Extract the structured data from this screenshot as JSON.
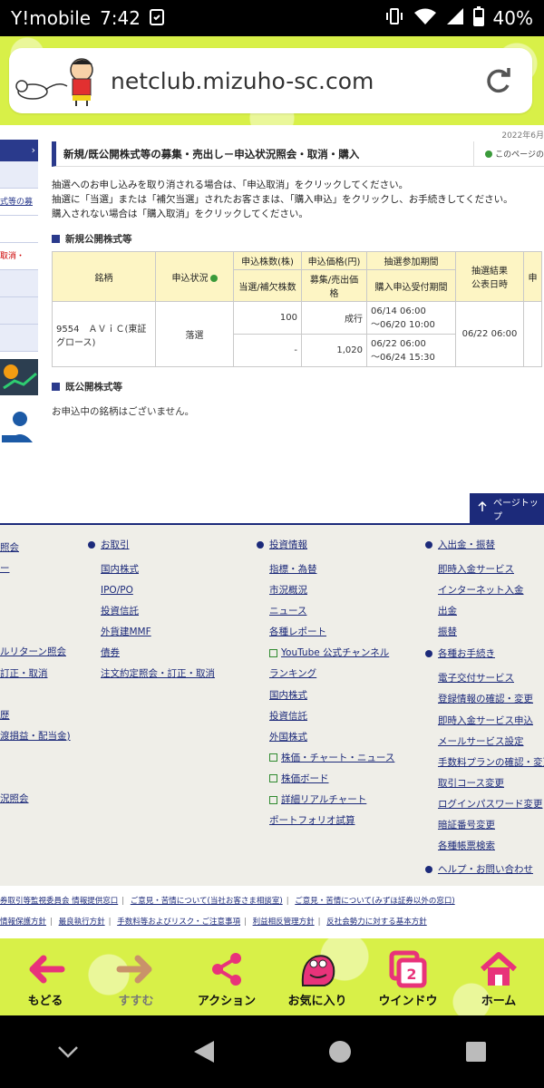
{
  "status": {
    "carrier": "Y!mobile",
    "time": "7:42",
    "battery": "40%"
  },
  "browser": {
    "url": "netclub.mizuho-sc.com"
  },
  "page": {
    "date_top": "2022年6月",
    "title": "新規/既公開株式等の募集・売出し－申込状況照会・取消・購入",
    "help_label": "このページの",
    "notes": [
      "抽選へのお申し込みを取り消される場合は、「申込取消」をクリックしてください。",
      "抽選に「当選」または「補欠当選」されたお客さまは、「購入申込」をクリックし、お手続きしてください。",
      "購入されない場合は「購入取消」をクリックしてください。"
    ],
    "sidebar_items": [
      "",
      "式等の募",
      "",
      "取消・",
      "",
      "",
      ""
    ],
    "section_new": "新規公開株式等",
    "table": {
      "h_name": "銘柄",
      "h_status": "申込状況",
      "h_qty": "申込株数(株)",
      "h_qty2": "当選/補欠株数",
      "h_price": "申込価格(円)",
      "h_price2": "募集/売出価格",
      "h_period": "抽選参加期間",
      "h_period2": "購入申込受付期間",
      "h_result": "抽選結果\n公表日時",
      "h_extra": "申",
      "row": {
        "name": "9554　ＡＶｉＣ(東証グロース)",
        "status": "落選",
        "qty": "100",
        "qty2": "-",
        "price": "成行",
        "price2": "1,020",
        "period_a": "06/14 06:00",
        "period_b": "～06/20 10:00",
        "period2_a": "06/22 06:00",
        "period2_b": "～06/24 15:30",
        "result": "06/22 06:00"
      }
    },
    "section_old": "既公開株式等",
    "no_entry": "お申込中の銘柄はございません。",
    "pagetop": "ページトップ"
  },
  "footer": {
    "col1": [
      "照会",
      "ー",
      "",
      "",
      "",
      "ルリターン照会",
      "訂正・取消",
      "",
      "歴",
      "渡損益・配当金)",
      "",
      "",
      "況照会"
    ],
    "col2_title": "お取引",
    "col2": [
      "国内株式",
      "IPO/PO",
      "投資信託",
      "外貨建MMF",
      "債券",
      "注文約定照会・訂正・取消"
    ],
    "col3_title": "投資情報",
    "col3": [
      "指標・為替",
      "市況概況",
      "ニュース",
      "各種レポート",
      "YouTube 公式チャンネル",
      "ランキング",
      "国内株式",
      "投資信託",
      "外国株式",
      "株価・チャート・ニュース",
      "株価ボード",
      "詳細リアルチャート",
      "ポートフォリオ試算"
    ],
    "col4_title": "入出金・振替",
    "col4": [
      "即時入金サービス",
      "インターネット入金",
      "出金",
      "振替"
    ],
    "col4_title2": "各種お手続き",
    "col4b": [
      "電子交付サービス",
      "登録情報の確認・変更",
      "即時入金サービス申込",
      "メールサービス設定",
      "手数料プランの確認・変更",
      "取引コース変更",
      "ログインパスワード変更",
      "暗証番号変更",
      "各種帳票検索"
    ],
    "col4_title3": "ヘルプ・お問い合わせ",
    "legal_row1": [
      "券取引等監視委員会 情報提供窓口",
      "ご意見・苦情について(当社お客さま相談室)",
      "ご意見・苦情について(みずほ証券以外の窓口)"
    ],
    "legal_row2": [
      "情報保護方針",
      "最良執行方針",
      "手数料等およびリスク・ご注意事項",
      "利益相反管理方針",
      "反社会勢力に対する基本方針"
    ]
  },
  "toolbar": {
    "back": "もどる",
    "forward": "すすむ",
    "action": "アクション",
    "favorite": "お気に入り",
    "window": "ウインドウ",
    "window_count": "2",
    "home": "ホーム"
  },
  "colors": {
    "brand_green": "#d8f048",
    "navy": "#1c2a7a",
    "pink": "#e8337a"
  }
}
